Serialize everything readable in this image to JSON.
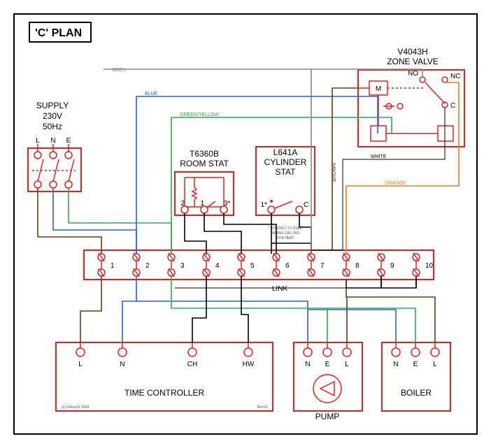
{
  "title": "'C' PLAN",
  "supply": {
    "label": "SUPPLY",
    "voltage": "230V",
    "freq": "50Hz",
    "L": "L",
    "N": "N",
    "E": "E"
  },
  "roomstat": {
    "model": "T6360B",
    "label": "ROOM STAT",
    "t1": "1",
    "t2": "2",
    "t3": "3*"
  },
  "cylstat": {
    "model": "L641A",
    "label1": "CYLINDER",
    "label2": "STAT",
    "t1": "1*",
    "tC": "C",
    "note1": "* CONTACT CLOSED",
    "note2": "MEANS CALLING",
    "note3": "FOR HEAT"
  },
  "zonevalve": {
    "model": "V4043H",
    "label": "ZONE VALVE",
    "M": "M",
    "NO": "NO",
    "NC": "NC",
    "C": "C"
  },
  "junction": {
    "labels": [
      "1",
      "2",
      "3",
      "4",
      "5",
      "6",
      "7",
      "8",
      "9",
      "10"
    ],
    "link": "LINK"
  },
  "timectrl": {
    "label": "TIME CONTROLLER",
    "L": "L",
    "N": "N",
    "CH": "CH",
    "HW": "HW",
    "rev": "Rev1d",
    "copy": "(c) DerwyGr 2003"
  },
  "pump": {
    "label": "PUMP",
    "N": "N",
    "E": "E",
    "L": "L"
  },
  "boiler": {
    "label": "BOILER",
    "N": "N",
    "E": "E",
    "L": "L"
  },
  "wires": {
    "grey": "GREY",
    "blue": "BLUE",
    "greenyellow": "GREEN/YELLOW",
    "brown": "BROWN",
    "white": "WHITE",
    "orange": "ORANGE"
  },
  "colors": {
    "red": "#d22",
    "blue": "#2a62d4",
    "green": "#2fa84f",
    "brown": "#6b3a17",
    "orange": "#f47c20",
    "grey": "#888",
    "black": "#000"
  }
}
